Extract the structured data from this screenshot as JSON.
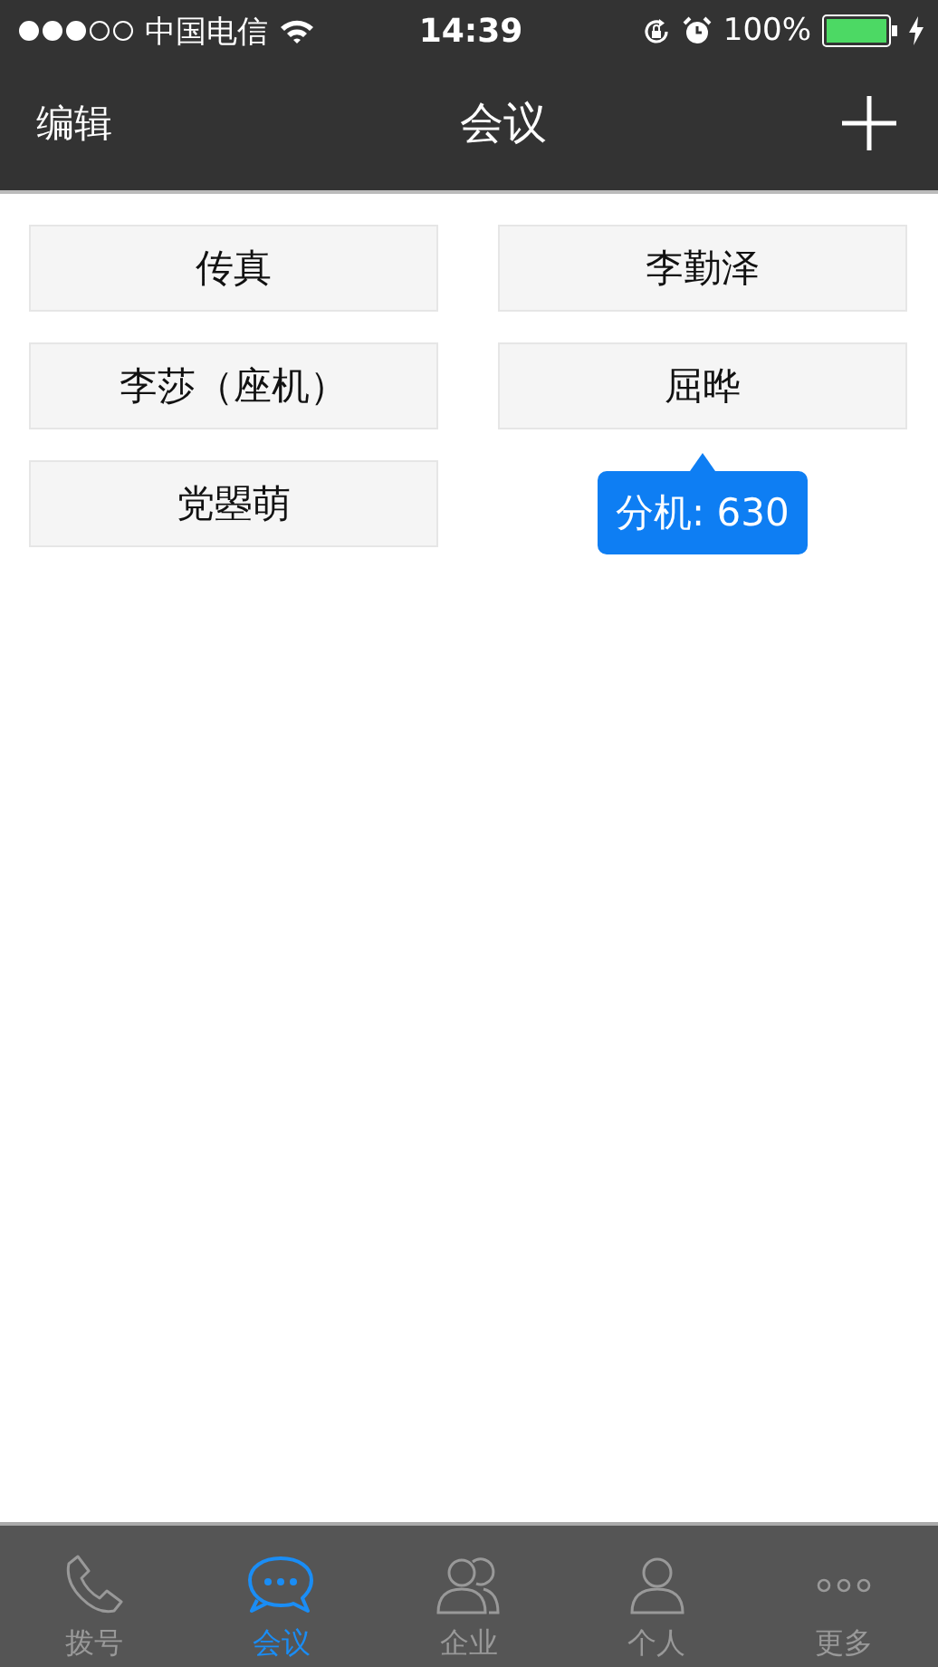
{
  "status_bar": {
    "carrier": "中国电信",
    "time": "14:39",
    "battery": "100%"
  },
  "nav": {
    "left": "编辑",
    "title": "会议"
  },
  "contacts": [
    {
      "name": "传真"
    },
    {
      "name": "李勤泽"
    },
    {
      "name": "李莎（座机）"
    },
    {
      "name": "屈晔"
    },
    {
      "name": "党曌萌"
    }
  ],
  "tooltip": {
    "text": "分机: 630"
  },
  "tabs": [
    {
      "label": "拨号",
      "kind": "phone",
      "selected": false
    },
    {
      "label": "会议",
      "kind": "chat",
      "selected": true
    },
    {
      "label": "企业",
      "kind": "group",
      "selected": false
    },
    {
      "label": "个人",
      "kind": "person",
      "selected": false
    },
    {
      "label": "更多",
      "kind": "more",
      "selected": false
    }
  ]
}
